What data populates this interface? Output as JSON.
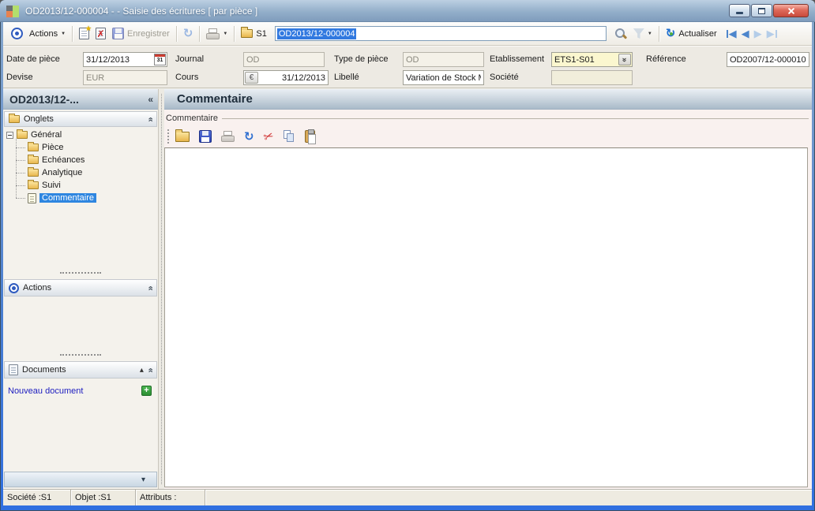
{
  "window": {
    "title": "OD2013/12-000004 -  -  Saisie des écritures [ par pièce ]"
  },
  "icons": {
    "dropdown": "▼",
    "chevron_double": "«",
    "star": "★",
    "delete_x": "✗",
    "scissors": "✂",
    "refresh": "↻",
    "nav_prev": "◀",
    "nav_next": "▶",
    "arrow_up": "▴",
    "arrow_down": "▾",
    "plus": "+",
    "euro": "€",
    "calendar_day": "31"
  },
  "toolbar": {
    "actions_label": "Actions",
    "save_label": "Enregistrer",
    "folder_label": "S1",
    "search_value": "OD2013/12-000004",
    "refresh_label": "Actualiser"
  },
  "form": {
    "date_piece": {
      "label": "Date de pièce",
      "value": "31/12/2013"
    },
    "journal": {
      "label": "Journal",
      "value": "OD"
    },
    "type_piece": {
      "label": "Type de pièce",
      "value": "OD"
    },
    "etablissement": {
      "label": "Etablissement",
      "value": "ETS1-S01"
    },
    "reference": {
      "label": "Référence",
      "value": "OD2007/12-000010"
    },
    "devise": {
      "label": "Devise",
      "value": "EUR"
    },
    "cours": {
      "label": "Cours",
      "value": "31/12/2013"
    },
    "libelle": {
      "label": "Libellé",
      "value": "Variation de Stock M"
    },
    "societe": {
      "label": "Société",
      "value": ""
    }
  },
  "sidebar": {
    "title": "OD2013/12-...",
    "sections": {
      "onglets": {
        "label": "Onglets"
      },
      "actions": {
        "label": "Actions"
      },
      "documents": {
        "label": "Documents",
        "new_document_label": "Nouveau document"
      }
    },
    "tree": {
      "root": {
        "label": "Général"
      },
      "items": [
        {
          "label": "Pièce"
        },
        {
          "label": "Echéances"
        },
        {
          "label": "Analytique"
        },
        {
          "label": "Suivi"
        },
        {
          "label": "Commentaire",
          "selected": true
        }
      ]
    }
  },
  "main": {
    "header": "Commentaire",
    "groupbox_label": "Commentaire",
    "comment_value": ""
  },
  "statusbar": {
    "societe": "Société :S1",
    "objet": "Objet :S1",
    "attributs": "Attributs :"
  }
}
